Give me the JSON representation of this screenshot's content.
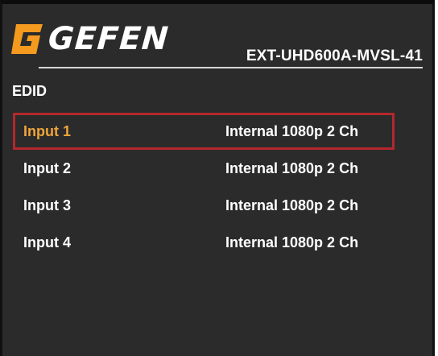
{
  "header": {
    "brand": "GEFEN",
    "model": "EXT-UHD600A-MVSL-41"
  },
  "menu": {
    "title": "EDID",
    "selected_index": 0,
    "items": [
      {
        "label": "Input 1",
        "value": "Internal 1080p 2 Ch"
      },
      {
        "label": "Input 2",
        "value": "Internal 1080p 2 Ch"
      },
      {
        "label": "Input 3",
        "value": "Internal 1080p 2 Ch"
      },
      {
        "label": "Input 4",
        "value": "Internal 1080p 2 Ch"
      }
    ]
  },
  "colors": {
    "background": "#2b2b2b",
    "selection_border": "#b3282d",
    "selected_text": "#f0a53a",
    "logo_orange": "#f39a1f",
    "text": "#ffffff"
  },
  "icons": {
    "logo": "gefen-logo-icon"
  }
}
